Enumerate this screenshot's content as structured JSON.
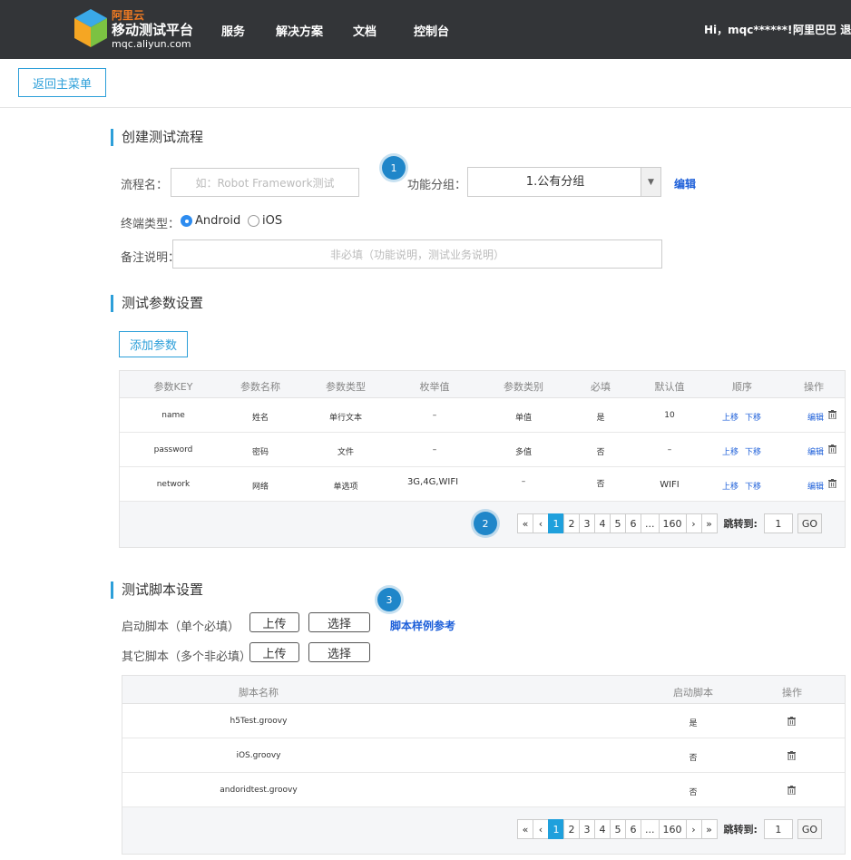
{
  "header": {
    "brand_cn": "阿里云",
    "brand_title": "移动测试平台",
    "brand_url": "mqc.aliyun.com",
    "nav": [
      "服务",
      "解决方案",
      "文档",
      "控制台"
    ],
    "greeting": "Hi，mqc******!",
    "company": "阿里巴巴",
    "company_tail": "退"
  },
  "back_button": "返回主菜单",
  "create": {
    "title": "创建测试流程",
    "flow_name_label": "流程名：",
    "flow_name_placeholder": "如：Robot Framework测试",
    "group_label": "功能分组：",
    "group_value": "1.公有分组",
    "edit_link": "编辑",
    "terminal_label": "终端类型：",
    "terminal_options": [
      "Android",
      "iOS"
    ],
    "terminal_selected": "Android",
    "remark_label": "备注说明：",
    "remark_placeholder": "非必填（功能说明，测试业务说明）"
  },
  "params": {
    "title": "测试参数设置",
    "add_button": "添加参数",
    "columns": [
      "参数KEY",
      "参数名称",
      "参数类型",
      "枚举值",
      "参数类别",
      "必填",
      "默认值",
      "顺序",
      "操作"
    ],
    "rows": [
      {
        "key": "name",
        "name": "姓名",
        "type": "单行文本",
        "enum": "–",
        "category": "单值",
        "required": "是",
        "default": "10"
      },
      {
        "key": "password",
        "name": "密码",
        "type": "文件",
        "enum": "–",
        "category": "多值",
        "required": "否",
        "default": "–"
      },
      {
        "key": "network",
        "name": "网络",
        "type": "单选项",
        "enum": "3G,4G,WIFI",
        "category": "–",
        "required": "否",
        "default": "WIFI"
      }
    ],
    "move_up": "上移",
    "move_down": "下移",
    "edit": "编辑"
  },
  "scripts": {
    "title": "测试脚本设置",
    "start_label": "启动脚本（单个必填）",
    "other_label": "其它脚本（多个非必填）",
    "upload": "上传",
    "choose": "选择",
    "sample_link": "脚本样例参考",
    "columns": [
      "脚本名称",
      "启动脚本",
      "操作"
    ],
    "rows": [
      {
        "name": "h5Test.groovy",
        "is_start": "是"
      },
      {
        "name": "iOS.groovy",
        "is_start": "否"
      },
      {
        "name": "andoridtest.groovy",
        "is_start": "否"
      }
    ]
  },
  "pager": {
    "first": "«",
    "prev": "‹",
    "pages": [
      "1",
      "2",
      "3",
      "4",
      "5",
      "6",
      "...",
      "160"
    ],
    "next": "›",
    "last": "»",
    "current": "1",
    "jump_label": "跳转到:",
    "jump_value": "1",
    "go": "GO"
  },
  "badges": [
    "1",
    "2",
    "3"
  ],
  "colors": {
    "accent": "#2d9fd9",
    "link": "#1d5fd9",
    "topbar": "#333538",
    "badge": "#1f86c9"
  }
}
